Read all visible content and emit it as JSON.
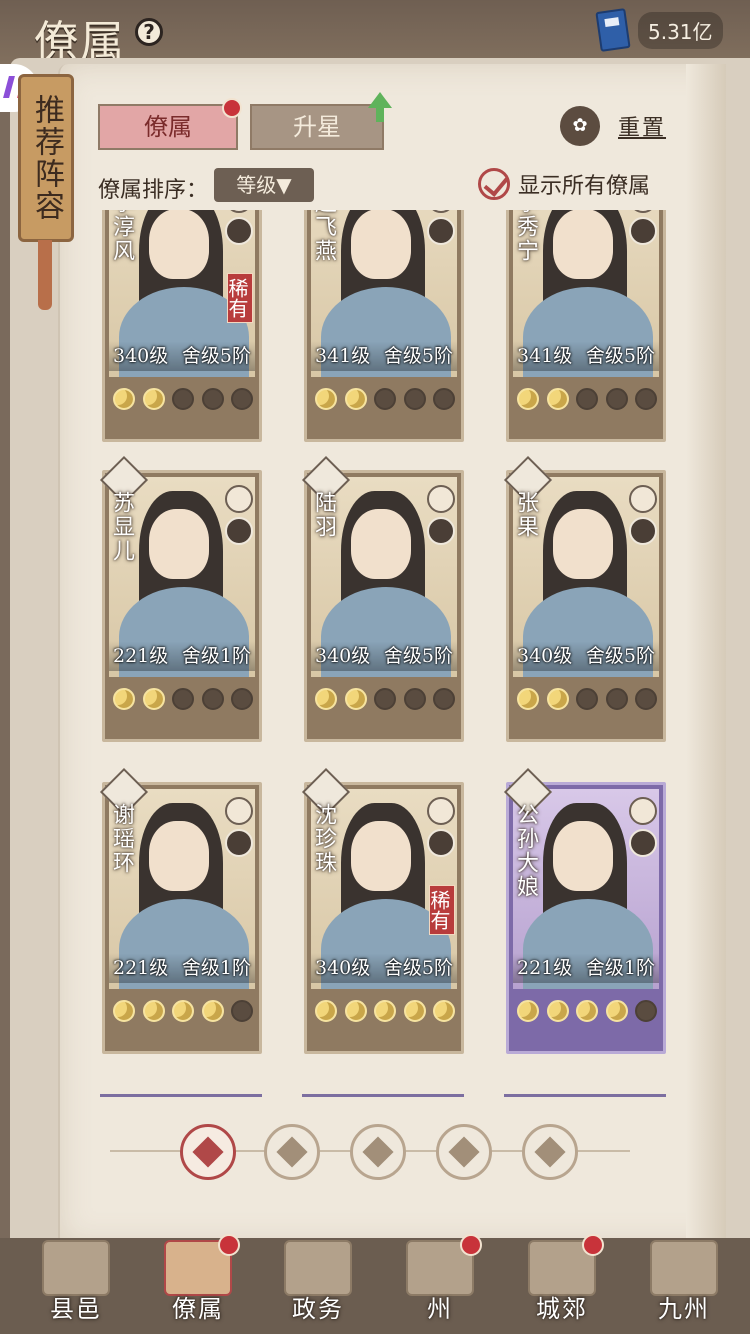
{
  "header": {
    "title": "僚属",
    "currency": "5.31亿"
  },
  "side_tab": {
    "label": "推荐阵容"
  },
  "tabs": [
    {
      "label": "僚属",
      "active": true,
      "badge": true
    },
    {
      "label": "升星",
      "active": false,
      "arrow_up": true
    }
  ],
  "reset_label": "重置",
  "sort": {
    "label": "僚属排序：",
    "value": "等级▼"
  },
  "show_all_label": "显示所有僚属",
  "cards": [
    {
      "name": "李淳风",
      "level": "340级",
      "rank": "舍级5阶",
      "moons": 2,
      "rare": "稀有",
      "theme": "normal"
    },
    {
      "name": "赵飞燕",
      "level": "341级",
      "rank": "舍级5阶",
      "moons": 2,
      "rare": "",
      "theme": "normal"
    },
    {
      "name": "李秀宁",
      "level": "341级",
      "rank": "舍级5阶",
      "moons": 2,
      "rare": "",
      "theme": "normal"
    },
    {
      "name": "苏显儿",
      "level": "221级",
      "rank": "舍级1阶",
      "moons": 2,
      "rare": "",
      "theme": "normal"
    },
    {
      "name": "陆羽",
      "level": "340级",
      "rank": "舍级5阶",
      "moons": 2,
      "rare": "",
      "theme": "normal"
    },
    {
      "name": "张果",
      "level": "340级",
      "rank": "舍级5阶",
      "moons": 2,
      "rare": "",
      "theme": "normal"
    },
    {
      "name": "谢瑶环",
      "level": "221级",
      "rank": "舍级1阶",
      "moons": 4,
      "rare": "",
      "theme": "normal"
    },
    {
      "name": "沈珍珠",
      "level": "340级",
      "rank": "舍级5阶",
      "moons": 5,
      "rare": "稀有",
      "theme": "normal"
    },
    {
      "name": "公孙大娘",
      "level": "221级",
      "rank": "舍级1阶",
      "moons": 4,
      "rare": "",
      "theme": "purple"
    }
  ],
  "filters": [
    "all-filter-icon",
    "helmet-filter-icon",
    "cat-filter-icon",
    "fan-filter-icon",
    "mountain-filter-icon"
  ],
  "nav": [
    {
      "label": "县邑",
      "badge": false
    },
    {
      "label": "僚属",
      "badge": true,
      "active": true
    },
    {
      "label": "政务",
      "badge": false
    },
    {
      "label": "州",
      "badge": true
    },
    {
      "label": "城郊",
      "badge": true
    },
    {
      "label": "九州",
      "badge": false
    }
  ],
  "colors": {
    "accent_red": "#c8333a",
    "purple_card": "#7d6aa8",
    "moon_on": "#f2d67a"
  }
}
